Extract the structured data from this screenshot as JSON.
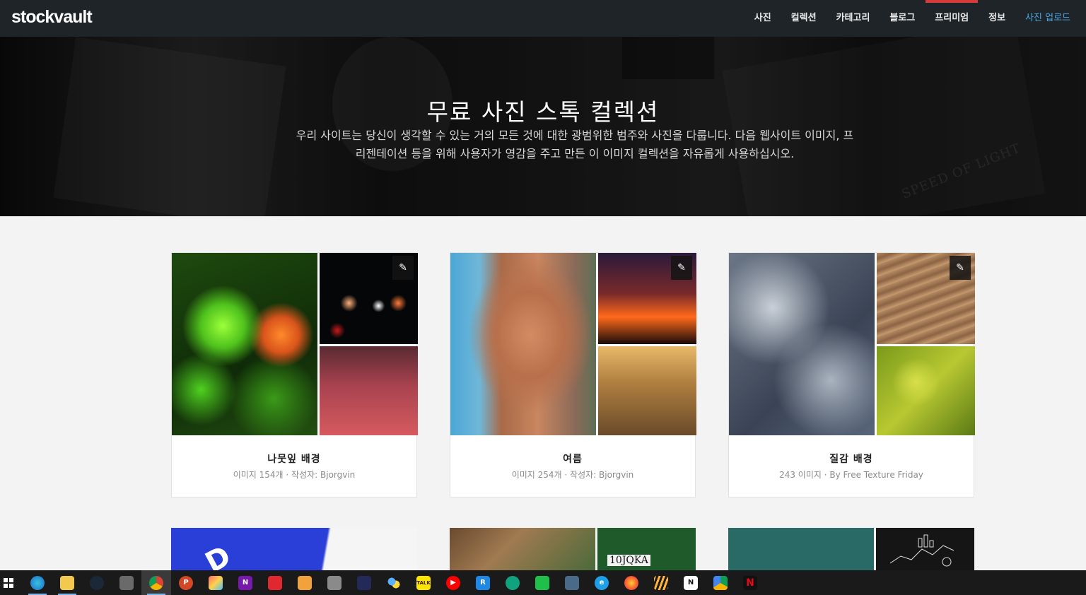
{
  "header": {
    "logo": "stockvault",
    "nav": [
      "사진",
      "컬렉션",
      "카테고리",
      "블로그",
      "프리미엄",
      "정보",
      "사진 업로드"
    ],
    "active_nav_index": 4
  },
  "hero": {
    "title": "무료 사진 스톡 컬렉션",
    "description_line1": "우리 사이트는 당신이 생각할 수 있는 거의 모든 것에 대한 광범위한 범주와 사진을 다룹니다. 다음 웹사이트 이미지, 프",
    "description_line2": "리젠테이션 등을 위해 사용자가 영감을 주고 만든 이 이미지 컬렉션을 자유롭게 사용하십시오.",
    "watermark": "SPEED OF LIGHT"
  },
  "collections": [
    {
      "title": "나뭇잎 배경",
      "meta": "이미지 154개 · 작성자: Bjorgvin"
    },
    {
      "title": "여름",
      "meta": "이미지 254개 · 작성자: Bjorgvin"
    },
    {
      "title": "질감 배경",
      "meta": "243 이미지 · By Free Texture Friday"
    }
  ],
  "partial_cards": [
    {
      "overlay_text": "D"
    },
    {
      "overlay_text": "10JQKA"
    },
    {
      "overlay_text": ""
    }
  ],
  "taskbar": {
    "icons": [
      "windows-start",
      "edge",
      "file-explorer",
      "steam",
      "snipping-tool",
      "chrome",
      "powerpoint",
      "paint",
      "onenote",
      "xmind",
      "app-orange",
      "app-gray",
      "app-navy",
      "app-bubbles",
      "kakaotalk",
      "youtube-music",
      "r-app",
      "chatgpt",
      "vpn",
      "calculator",
      "internet-explorer",
      "firefox",
      "stripes-app",
      "notion",
      "drive",
      "netflix"
    ],
    "running": [
      "edge",
      "file-explorer",
      "chrome"
    ],
    "active": "chrome"
  }
}
